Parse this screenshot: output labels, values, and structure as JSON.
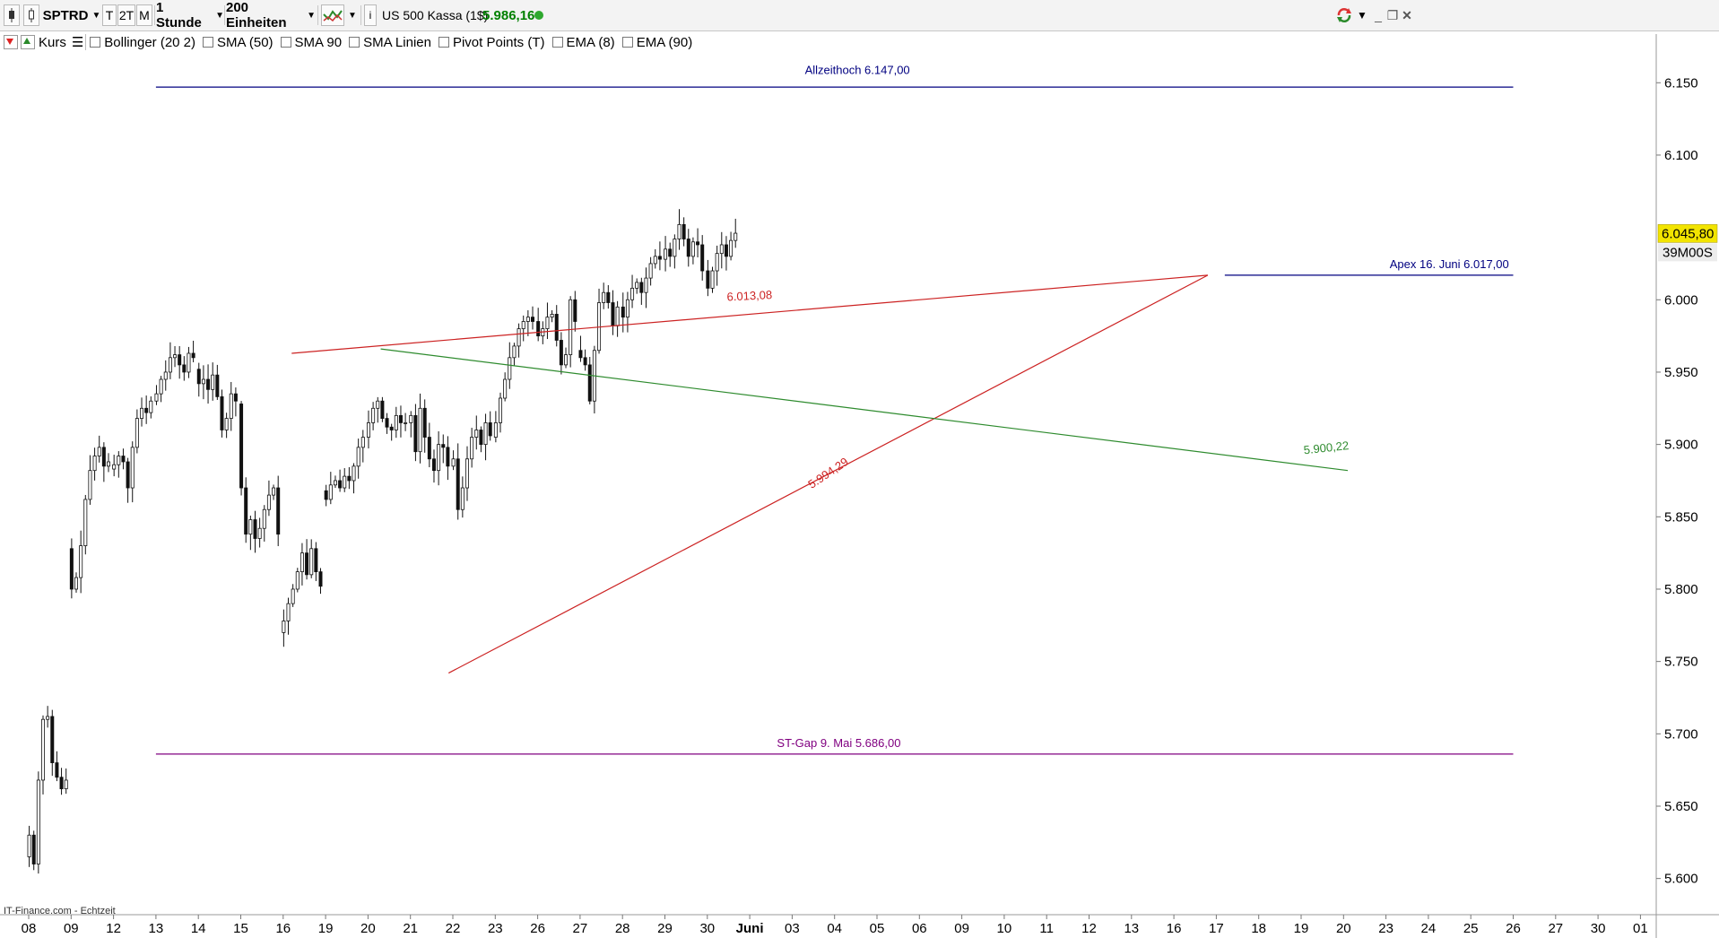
{
  "toolbar": {
    "symbol": "SPTRD",
    "period_t": "T",
    "period_2t": "2T",
    "period_m": "M",
    "interval": "1 Stunde",
    "units": "200 Einheiten",
    "instrument": "US 500 Kassa (1$)",
    "price": "5.986,16",
    "price_color": "#008000",
    "icons": [
      "chart-menu-icon",
      "chart-type-icon",
      "info-icon",
      "refresh-icon",
      "minimize-icon",
      "restore-icon",
      "close-icon"
    ]
  },
  "indicators": [
    {
      "label": "Kurs",
      "checked": false
    },
    {
      "label": "Bollinger (20 2)",
      "checked": false
    },
    {
      "label": "SMA (50)",
      "checked": false
    },
    {
      "label": "SMA 90",
      "checked": false
    },
    {
      "label": "SMA Linien",
      "checked": false
    },
    {
      "label": "Pivot Points (T)",
      "checked": false
    },
    {
      "label": "EMA (8)",
      "checked": false
    },
    {
      "label": "EMA (90)",
      "checked": false
    }
  ],
  "source": "IT-Finance.com - Echtzeit",
  "chart_data": {
    "type": "candlestick",
    "ylim": [
      5575,
      6170
    ],
    "y_ticks": [
      {
        "value": 6150,
        "label": "6.150"
      },
      {
        "value": 6100,
        "label": "6.100"
      },
      {
        "value": 6000,
        "label": "6.000"
      },
      {
        "value": 5950,
        "label": "5.950"
      },
      {
        "value": 5900,
        "label": "5.900"
      },
      {
        "value": 5850,
        "label": "5.850"
      },
      {
        "value": 5800,
        "label": "5.800"
      },
      {
        "value": 5750,
        "label": "5.750"
      },
      {
        "value": 5700,
        "label": "5.700"
      },
      {
        "value": 5650,
        "label": "5.650"
      },
      {
        "value": 5600,
        "label": "5.600"
      }
    ],
    "x_ticks": [
      "08",
      "09",
      "12",
      "13",
      "14",
      "15",
      "16",
      "19",
      "20",
      "21",
      "22",
      "23",
      "26",
      "27",
      "28",
      "29",
      "30",
      "Juni",
      "03",
      "04",
      "05",
      "06",
      "09",
      "10",
      "11",
      "12",
      "13",
      "16",
      "17",
      "18",
      "19",
      "20",
      "23",
      "24",
      "25",
      "26",
      "27",
      "30",
      "01"
    ],
    "bold_ticks": [
      "Juni"
    ],
    "last_price": {
      "value": 6045.8,
      "label": "6.045,80",
      "timer": "39M00S"
    },
    "candle_days": [
      {
        "start": 5615,
        "levels": [
          5630,
          5610,
          5668,
          5710,
          5712,
          5680,
          5670,
          5662,
          5668
        ]
      },
      {
        "start": 5828,
        "levels": [
          5800,
          5808,
          5830,
          5862,
          5882,
          5892,
          5898,
          5885,
          5888
        ]
      },
      {
        "start": 5883,
        "levels": [
          5886,
          5892,
          5888,
          5870,
          5898,
          5918,
          5925,
          5922,
          5930
        ]
      },
      {
        "start": 5930,
        "levels": [
          5935,
          5945,
          5950,
          5960,
          5962,
          5955,
          5950,
          5963,
          5960
        ]
      },
      {
        "start": 5952,
        "levels": [
          5942,
          5945,
          5938,
          5948,
          5933,
          5910,
          5918,
          5935,
          5930
        ]
      },
      {
        "start": 5928,
        "levels": [
          5870,
          5838,
          5848,
          5835,
          5842,
          5855,
          5865,
          5870,
          5838
        ]
      },
      {
        "start": 5770,
        "levels": [
          5778,
          5790,
          5800,
          5812,
          5825,
          5810,
          5828,
          5812,
          5802
        ]
      },
      {
        "start": 5868,
        "levels": [
          5862,
          5872,
          5875,
          5870,
          5878,
          5875,
          5885,
          5898,
          5905
        ]
      },
      {
        "start": 5905,
        "levels": [
          5915,
          5925,
          5930,
          5918,
          5912,
          5910,
          5920,
          5915,
          5915
        ]
      },
      {
        "start": 5915,
        "levels": [
          5920,
          5895,
          5925,
          5905,
          5890,
          5882,
          5900,
          5898,
          5885
        ]
      },
      {
        "start": 5885,
        "levels": [
          5890,
          5855,
          5870,
          5890,
          5905,
          5910,
          5900,
          5915,
          5906
        ]
      },
      {
        "start": 5905,
        "levels": [
          5915,
          5932,
          5945,
          5960,
          5968,
          5980,
          5985,
          5988,
          5985
        ]
      },
      {
        "start": 5985,
        "levels": [
          5975,
          5980,
          5988,
          5990,
          5972,
          5955,
          5962,
          6000,
          5985
        ]
      },
      {
        "start": 5965,
        "levels": [
          5960,
          5955,
          5930,
          5965,
          5998,
          6005,
          5998,
          5982,
          5995
        ]
      },
      {
        "start": 5995,
        "levels": [
          5988,
          6000,
          6008,
          6012,
          6005,
          6015,
          6025,
          6030,
          6028
        ]
      },
      {
        "start": 6028,
        "levels": [
          6035,
          6030,
          6042,
          6052,
          6042,
          6030,
          6040,
          6038,
          6020
        ]
      },
      {
        "start": 6020,
        "levels": [
          6008,
          6020,
          6032,
          6038,
          6030,
          6041,
          6046
        ]
      }
    ],
    "annotations": [
      {
        "type": "line",
        "name": "allzeithoch-line",
        "color": "#000080",
        "from": [
          3,
          6147
        ],
        "to": [
          35,
          6147
        ]
      },
      {
        "type": "text",
        "text": "Allzeithoch 6.147,00",
        "color": "#000080",
        "at": [
          18.3,
          6156
        ],
        "anchor": "start"
      },
      {
        "type": "line",
        "name": "apex-line",
        "color": "#000080",
        "from": [
          28.2,
          6017
        ],
        "to": [
          35,
          6017
        ]
      },
      {
        "type": "text",
        "text": "Apex 16. Juni  6.017,00",
        "color": "#000080",
        "at": [
          34.9,
          6022
        ],
        "anchor": "end"
      },
      {
        "type": "line",
        "name": "st-gap-line",
        "color": "#800080",
        "from": [
          3,
          5686
        ],
        "to": [
          35,
          5686
        ]
      },
      {
        "type": "text",
        "text": "ST-Gap 9. Mai  5.686,00",
        "color": "#800080",
        "at": [
          19.1,
          5691
        ],
        "anchor": "middle"
      },
      {
        "type": "line",
        "name": "upper-resistance-line",
        "color": "#cc2222",
        "from": [
          6.2,
          5963
        ],
        "to": [
          27.8,
          6017
        ]
      },
      {
        "type": "text",
        "text": "6.013,08",
        "color": "#cc2222",
        "at": [
          17,
          6000
        ],
        "anchor": "middle",
        "angle": -2.8
      },
      {
        "type": "line",
        "name": "lower-support-line",
        "color": "#cc2222",
        "from": [
          9.9,
          5742
        ],
        "to": [
          27.8,
          6017
        ]
      },
      {
        "type": "text",
        "text": "5.994,29",
        "color": "#cc2222",
        "at": [
          18.9,
          5878
        ],
        "anchor": "middle",
        "angle": -34
      },
      {
        "type": "line",
        "name": "green-trend-line",
        "color": "#2e8b2e",
        "from": [
          8.3,
          5966
        ],
        "to": [
          31.1,
          5882
        ]
      },
      {
        "type": "text",
        "text": "5.900,22",
        "color": "#2e8b2e",
        "at": [
          30.6,
          5895
        ],
        "anchor": "middle",
        "angle": -6
      }
    ]
  }
}
